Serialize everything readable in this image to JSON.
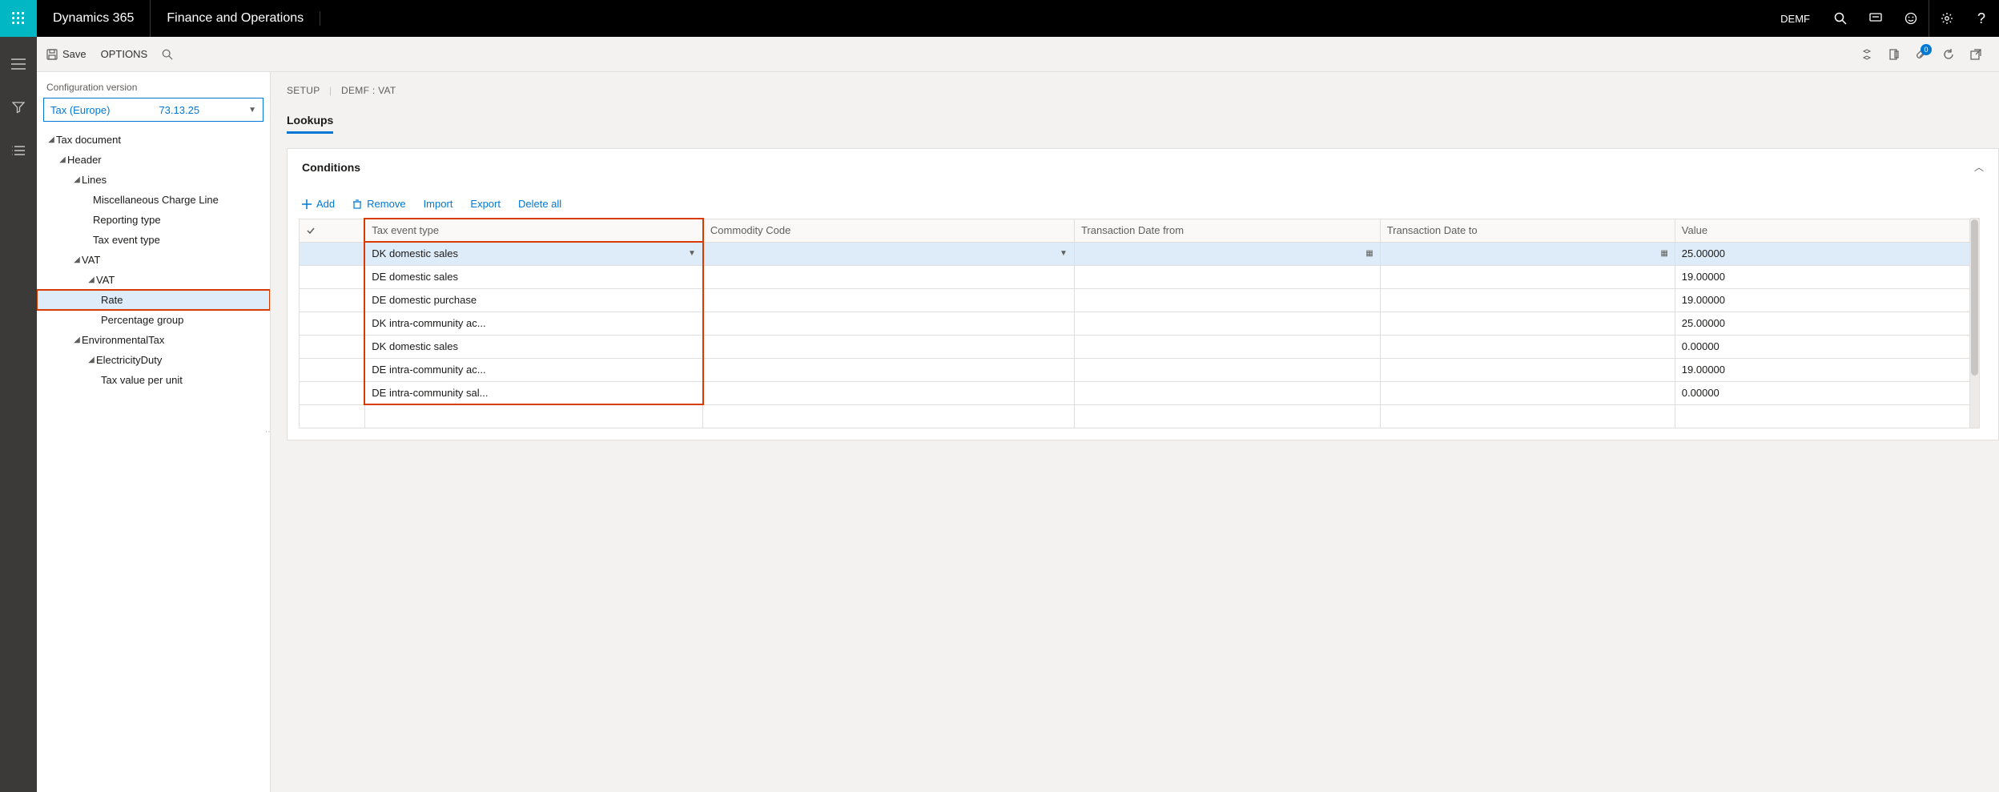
{
  "topbar": {
    "brand": "Dynamics 365",
    "module": "Finance and Operations",
    "company": "DEMF",
    "attachments_count": "0"
  },
  "actionbar": {
    "save": "Save",
    "options": "OPTIONS"
  },
  "nav": {
    "config_label": "Configuration version",
    "config_name": "Tax (Europe)",
    "config_version": "73.13.25",
    "tree": {
      "tax_document": "Tax document",
      "header": "Header",
      "lines": "Lines",
      "misc_charge_line": "Miscellaneous Charge Line",
      "reporting_type": "Reporting type",
      "tax_event_type": "Tax event type",
      "vat": "VAT",
      "vat_sub": "VAT",
      "rate": "Rate",
      "percentage_group": "Percentage group",
      "environmental_tax": "EnvironmentalTax",
      "electricity_duty": "ElectricityDuty",
      "tax_value_per_unit": "Tax value per unit"
    }
  },
  "breadcrumb": {
    "setup": "SETUP",
    "entity": "DEMF : VAT"
  },
  "tabs": {
    "lookups": "Lookups"
  },
  "panel": {
    "title": "Conditions",
    "toolbar": {
      "add": "Add",
      "remove": "Remove",
      "import": "Import",
      "export": "Export",
      "delete_all": "Delete all"
    },
    "columns": {
      "tax_event_type": "Tax event type",
      "commodity_code": "Commodity Code",
      "tx_date_from": "Transaction Date from",
      "tx_date_to": "Transaction Date to",
      "value": "Value"
    },
    "rows": [
      {
        "tax_event_type": "DK domestic sales",
        "commodity_code": "",
        "date_from": "",
        "date_to": "",
        "value": "25.00000"
      },
      {
        "tax_event_type": "DE domestic sales",
        "commodity_code": "",
        "date_from": "",
        "date_to": "",
        "value": "19.00000"
      },
      {
        "tax_event_type": "DE domestic purchase",
        "commodity_code": "",
        "date_from": "",
        "date_to": "",
        "value": "19.00000"
      },
      {
        "tax_event_type": "DK intra-community ac...",
        "commodity_code": "",
        "date_from": "",
        "date_to": "",
        "value": "25.00000"
      },
      {
        "tax_event_type": "DK domestic sales",
        "commodity_code": "",
        "date_from": "",
        "date_to": "",
        "value": "0.00000"
      },
      {
        "tax_event_type": "DE intra-community ac...",
        "commodity_code": "",
        "date_from": "",
        "date_to": "",
        "value": "19.00000"
      },
      {
        "tax_event_type": "DE intra-community sal...",
        "commodity_code": "",
        "date_from": "",
        "date_to": "",
        "value": "0.00000"
      }
    ]
  }
}
